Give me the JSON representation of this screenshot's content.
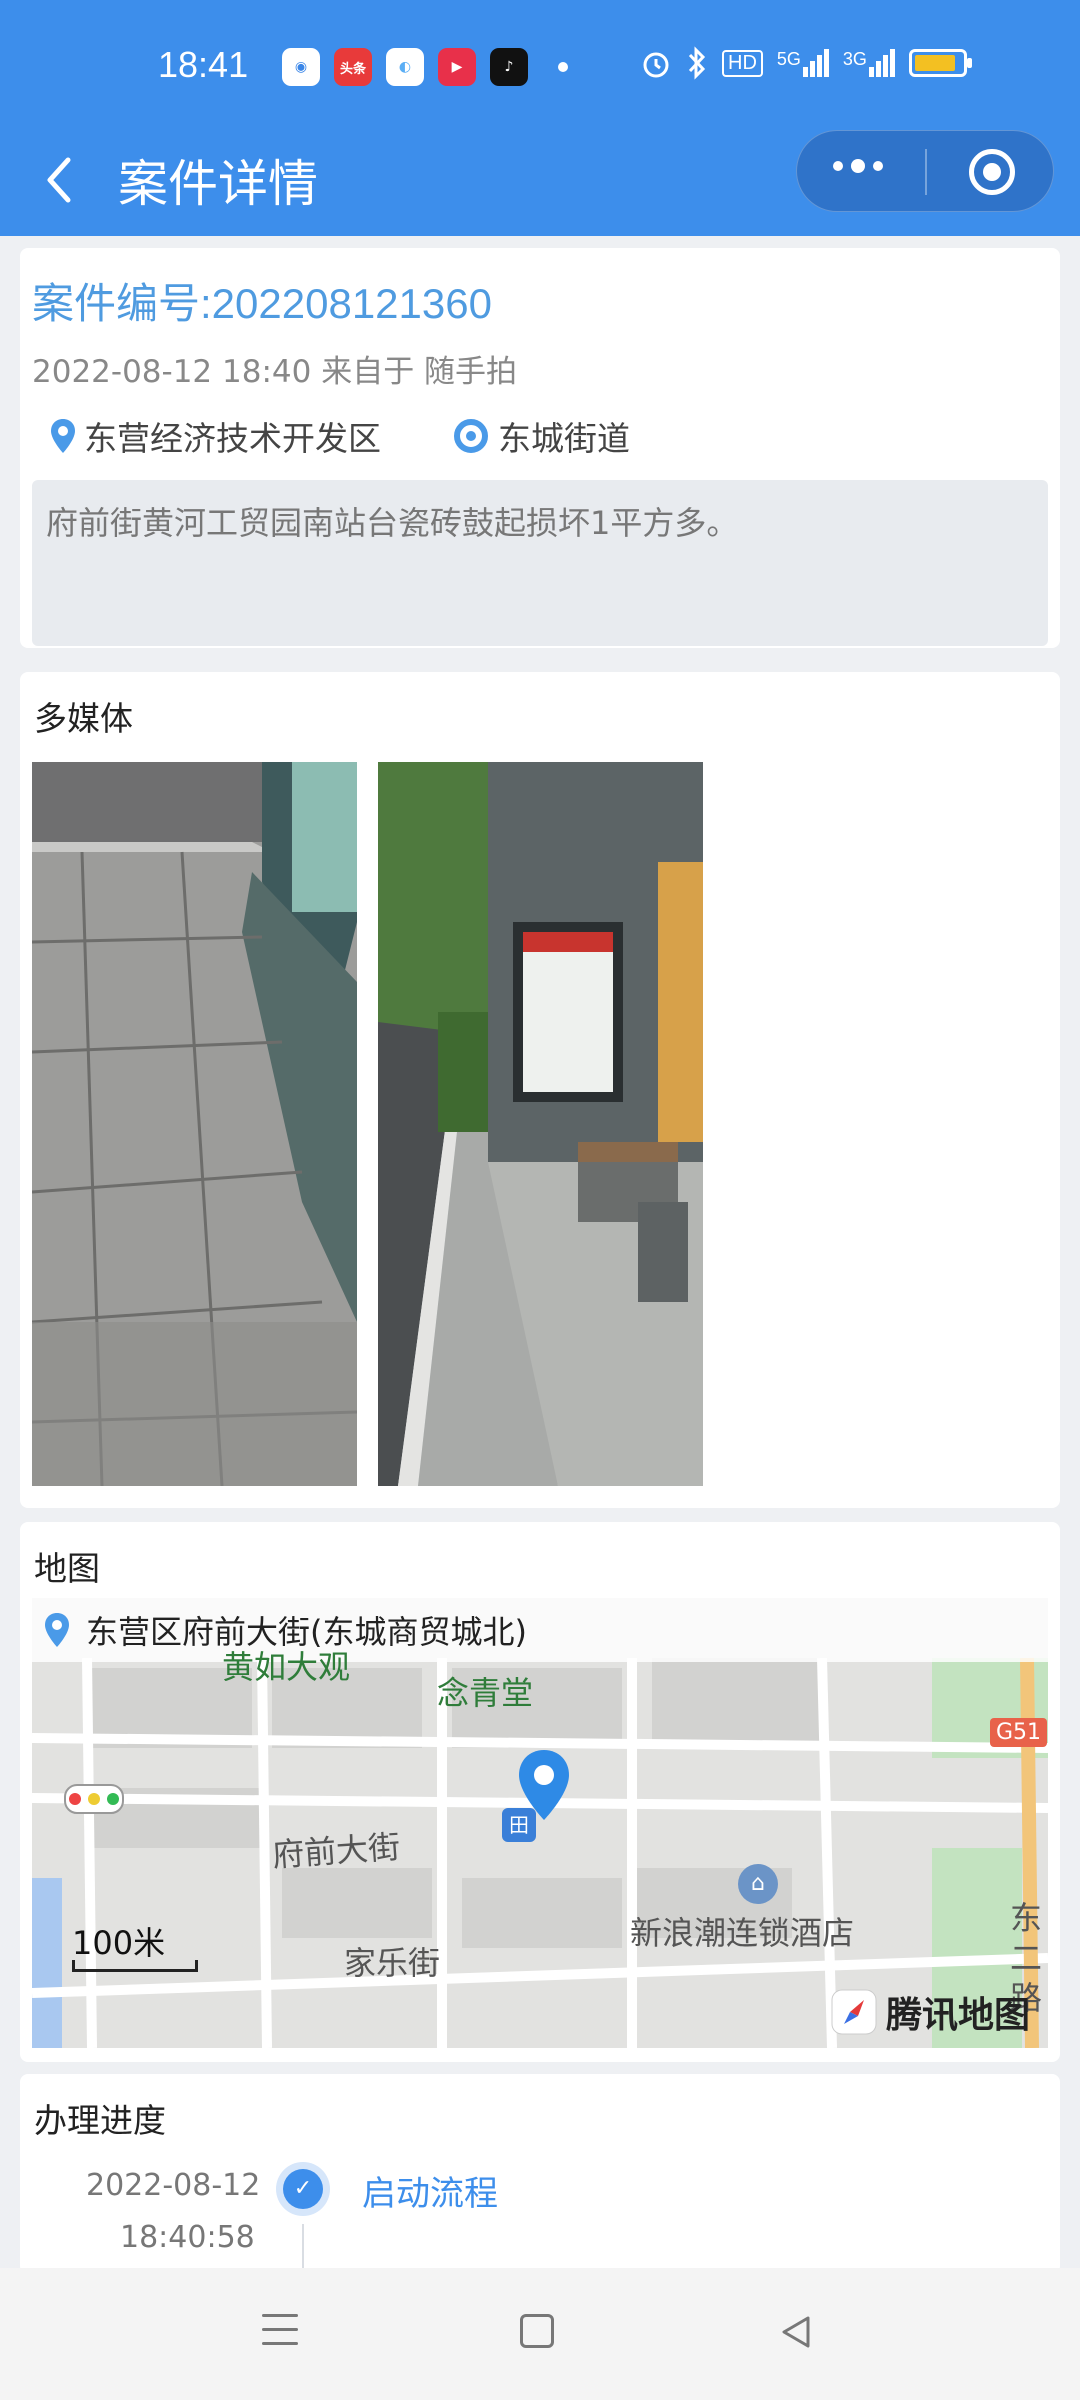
{
  "status_bar": {
    "time": "18:41",
    "app_icons": [
      {
        "name": "tracker-app-icon",
        "color": "#3a86e8",
        "glyph": "◉"
      },
      {
        "name": "toutiao-app-icon",
        "color": "#e83a3a",
        "glyph": "头条"
      },
      {
        "name": "browser-app-icon",
        "color": "#5aaef5",
        "glyph": "◐"
      },
      {
        "name": "video-app-icon",
        "color": "#e8304a",
        "glyph": "▶"
      },
      {
        "name": "tiktok-app-icon",
        "color": "#111111",
        "glyph": "♪"
      }
    ],
    "network": "HD",
    "signal_1": "5G",
    "signal_2": "3G",
    "battery_color": "#f3c022"
  },
  "header": {
    "title": "案件详情",
    "accent_color": "#3d8eeb"
  },
  "case": {
    "number_label": "案件编号:202208121360",
    "meta": "2022-08-12 18:40 来自于 随手拍",
    "district": "东营经济技术开发区",
    "street": "东城街道",
    "description": "府前街黄河工贸园南站台瓷砖鼓起损坏1平方多。"
  },
  "media": {
    "title": "多媒体",
    "photos": [
      {
        "name": "damaged-paving-photo"
      },
      {
        "name": "bus-stop-photo"
      }
    ]
  },
  "map": {
    "title": "地图",
    "address": "东营区府前大街(东城商贸城北)",
    "labels": {
      "top_left": "黄如大观",
      "nianqing": "念青堂",
      "fuqian": "府前大街",
      "jiale": "家乐街",
      "hotel": "新浪潮连锁酒店",
      "east_road": "东二路",
      "highway": "G51"
    },
    "scale_label": "100米",
    "provider": "腾讯地图"
  },
  "progress": {
    "title": "办理进度",
    "steps": [
      {
        "date": "2022-08-12",
        "time": "18:40:58",
        "label": "启动流程"
      }
    ]
  }
}
